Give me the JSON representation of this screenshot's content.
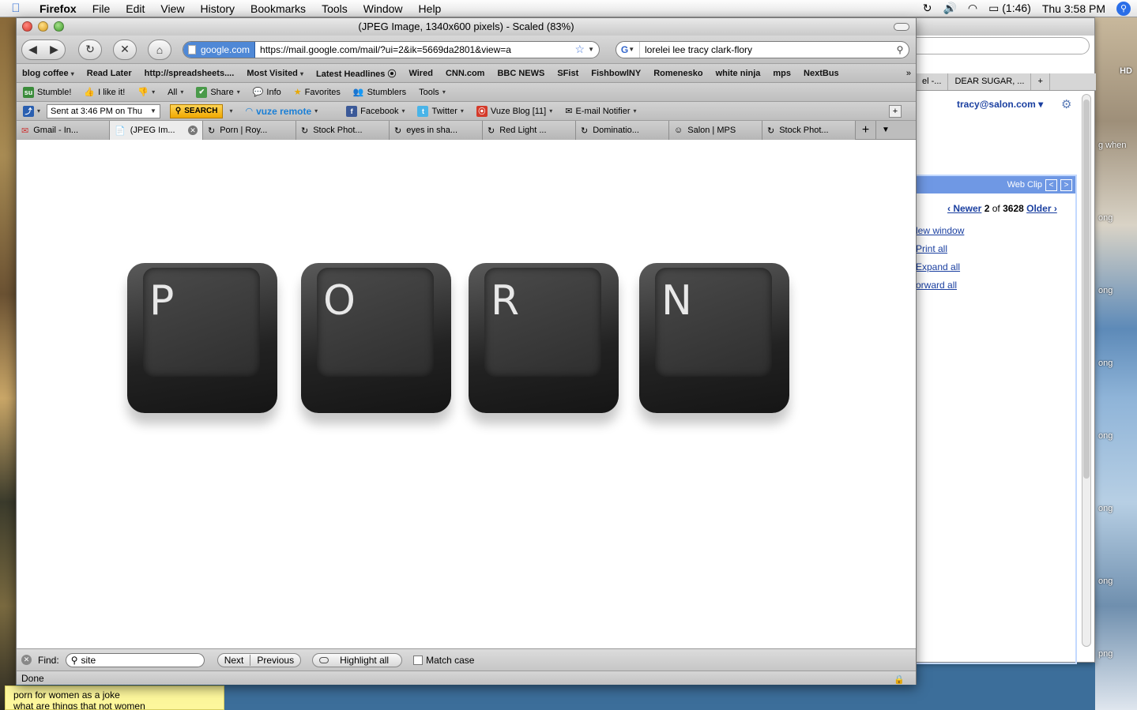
{
  "menubar": {
    "app": "Firefox",
    "items": [
      "File",
      "Edit",
      "View",
      "History",
      "Bookmarks",
      "Tools",
      "Window",
      "Help"
    ],
    "battery": "(1:46)",
    "clock": "Thu 3:58 PM"
  },
  "window": {
    "title": "(JPEG Image, 1340x600 pixels) - Scaled (83%)"
  },
  "navbar": {
    "site_identity": "google.com",
    "url": "https://mail.google.com/mail/?ui=2&ik=5669da2801&view=a",
    "search_query": "lorelei lee tracy clark-flory"
  },
  "bookmarks": [
    "blog coffee",
    "Read Later",
    "http://spreadsheets....",
    "Most Visited",
    "Latest Headlines",
    "Wired",
    "CNN.com",
    "BBC NEWS",
    "SFist",
    "FishbowlNY",
    "Romenesko",
    "white ninja",
    "mps",
    "NextBus"
  ],
  "stumble_toolbar": {
    "stumble": "Stumble!",
    "like": "I like it!",
    "all": "All",
    "share": "Share",
    "info": "Info",
    "favorites": "Favorites",
    "stumblers": "Stumblers",
    "tools": "Tools"
  },
  "vuze_toolbar": {
    "sent": "Sent at 3:46 PM on Thu",
    "search": "SEARCH",
    "vuze_remote": "vuze remote",
    "facebook": "Facebook",
    "twitter": "Twitter",
    "vuze_blog": "Vuze Blog [11]",
    "email_notifier": "E-mail Notifier"
  },
  "tabs": [
    "Gmail - In...",
    "(JPEG Im...",
    "Porn | Roy...",
    "Stock Phot...",
    "eyes in sha...",
    "Red Light ...",
    "Dominatio...",
    "Salon | MPS",
    "Stock Phot..."
  ],
  "image_keys": [
    "P",
    "O",
    "R",
    "N"
  ],
  "findbar": {
    "label": "Find:",
    "query": "site",
    "next": "Next",
    "previous": "Previous",
    "highlight_all": "Highlight all",
    "match_case": "Match case"
  },
  "status": "Done",
  "gmail_bg": {
    "tab1": "el -...",
    "tab2": "DEAR SUGAR, ...",
    "account": "tracy@salon.com",
    "web_clip": "Web Clip",
    "newer": "‹ Newer",
    "count_current": "2",
    "of": "of",
    "count_total": "3628",
    "older": "Older ›",
    "links": [
      "lew window",
      "Print all",
      "Expand all",
      "orward all"
    ]
  },
  "desktop": {
    "hd_label": "HD",
    "side_labels": [
      "g when",
      "ong",
      "ong",
      "ong",
      "ong",
      "ong",
      "ong",
      "ong",
      "png"
    ],
    "sticky_lines": [
      "porn for women as a joke",
      "what are things that not women"
    ]
  }
}
